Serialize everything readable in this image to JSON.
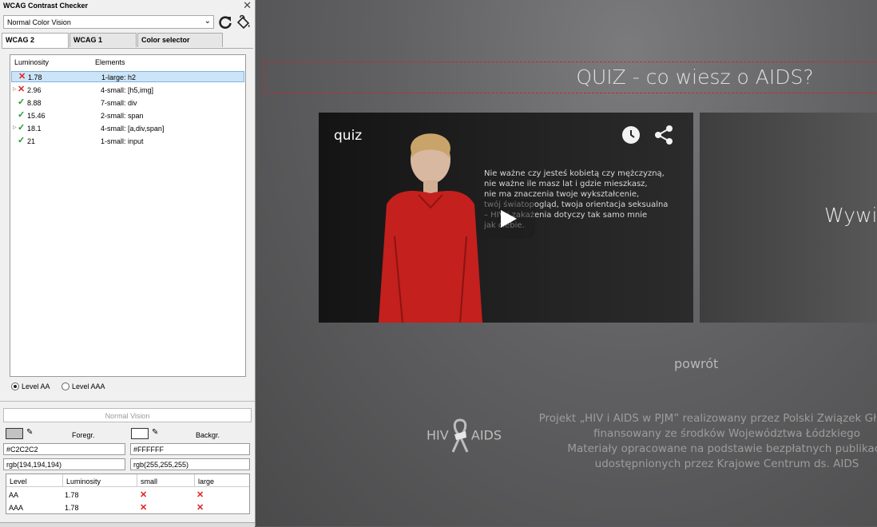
{
  "extension": {
    "title": "WCAG Contrast Checker",
    "vision_mode": "Normal Color Vision",
    "tabs": [
      {
        "label": "WCAG 2",
        "active": true
      },
      {
        "label": "WCAG 1",
        "active": false
      },
      {
        "label": "Color selector",
        "active": false
      }
    ],
    "list": {
      "headers": {
        "luminosity": "Luminosity",
        "elements": "Elements"
      },
      "rows": [
        {
          "status": "fail",
          "luminosity": "1.78",
          "elements": "1-large: h2",
          "selected": true,
          "expandable": false
        },
        {
          "status": "fail",
          "luminosity": "2.96",
          "elements": "4-small: [h5,img]",
          "selected": false,
          "expandable": true
        },
        {
          "status": "pass",
          "luminosity": "8.88",
          "elements": "7-small: div",
          "selected": false,
          "expandable": false
        },
        {
          "status": "pass",
          "luminosity": "15.46",
          "elements": "2-small: span",
          "selected": false,
          "expandable": false
        },
        {
          "status": "pass",
          "luminosity": "18.1",
          "elements": "4-small: [a,div,span]",
          "selected": false,
          "expandable": true
        },
        {
          "status": "pass",
          "luminosity": "21",
          "elements": "1-small: input",
          "selected": false,
          "expandable": false
        }
      ]
    },
    "levels": {
      "aa": "Level AA",
      "aaa": "Level AAA",
      "selected": "aa"
    },
    "normal_vision": "Normal Vision",
    "foreground": {
      "label": "Foregr.",
      "hex": "#C2C2C2",
      "rgb": "rgb(194,194,194)",
      "color": "#C2C2C2"
    },
    "background": {
      "label": "Backgr.",
      "hex": "#FFFFFF",
      "rgb": "rgb(255,255,255)",
      "color": "#FFFFFF"
    },
    "results": {
      "headers": {
        "level": "Level",
        "luminosity": "Luminosity",
        "small": "small",
        "large": "large"
      },
      "rows": [
        {
          "level": "AA",
          "luminosity": "1.78",
          "small": "fail",
          "large": "fail"
        },
        {
          "level": "AAA",
          "luminosity": "1.78",
          "small": "fail",
          "large": "fail"
        }
      ]
    }
  },
  "page": {
    "heading": "QUIZ - co wiesz o AIDS?",
    "video": {
      "title": "quiz",
      "caption_lines": [
        "Nie ważne czy jesteś kobietą czy mężczyzną,",
        "nie ważne ile masz lat i gdzie mieszkasz,",
        "nie ma znaczenia twoje wykształcenie,",
        "twój światopogląd, twoja orientacja seksualna",
        "– HIV i zakażenia dotyczy tak samo mnie",
        "jak ciebie."
      ]
    },
    "panel_text": "Wywia",
    "back_link": "powrót",
    "logo_text": {
      "left": "HIV",
      "right": "AIDS"
    },
    "footer_lines": [
      "Projekt „HIV i AIDS w PJM” realizowany przez Polski Związek Głuchych",
      "finansowany ze środków Województwa Łódzkiego",
      "Materiały opracowane na podstawie bezpłatnych publikacji",
      "udostępnionych przez Krajowe Centrum ds. AIDS"
    ]
  }
}
